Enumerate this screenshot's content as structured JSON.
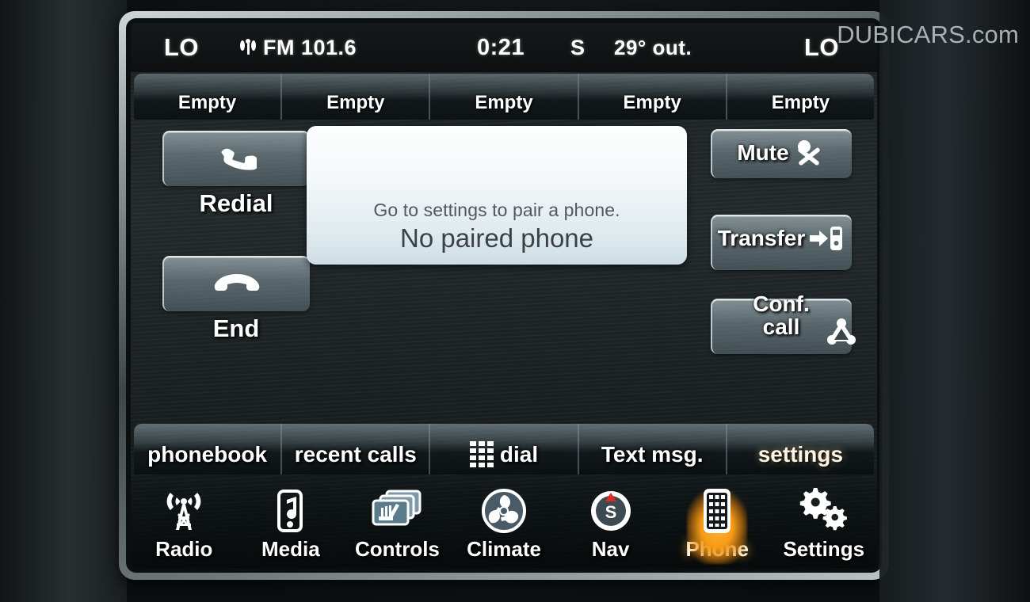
{
  "watermark": "DUBICARS.com",
  "status_bar": {
    "left_climate": "LO",
    "source_icon": "antenna-icon",
    "source": "FM 101.6",
    "time": "0:21",
    "gear": "S",
    "temperature": "29° out.",
    "right_climate": "LO"
  },
  "presets": [
    {
      "label": "Empty"
    },
    {
      "label": "Empty"
    },
    {
      "label": "Empty"
    },
    {
      "label": "Empty"
    },
    {
      "label": "Empty"
    }
  ],
  "left_buttons": [
    {
      "label": "Redial",
      "icon": "phone-handset-icon"
    },
    {
      "label": "End",
      "icon": "phone-hangup-icon"
    }
  ],
  "right_buttons": [
    {
      "label": "Mute",
      "icon": "microphone-muted-icon"
    },
    {
      "label": "Transfer",
      "icon": "transfer-to-phone-icon"
    },
    {
      "label": "Conf.",
      "label2": "call",
      "icon": "conference-call-icon"
    }
  ],
  "message": {
    "subtitle": "Go to settings to pair a phone.",
    "title": "No paired phone"
  },
  "tabs": [
    {
      "label": "phonebook",
      "icon": "",
      "selected": false
    },
    {
      "label": "recent calls",
      "icon": "",
      "selected": false
    },
    {
      "label": "dial",
      "icon": "keypad-icon",
      "selected": false
    },
    {
      "label": "Text msg.",
      "icon": "",
      "selected": false
    },
    {
      "label": "settings",
      "icon": "",
      "selected": true
    }
  ],
  "nav_items": [
    {
      "label": "Radio",
      "icon": "radio-tower-icon",
      "active": false
    },
    {
      "label": "Media",
      "icon": "media-player-icon",
      "active": false
    },
    {
      "label": "Controls",
      "icon": "seat-controls-icon",
      "active": false
    },
    {
      "label": "Climate",
      "icon": "climate-fan-icon",
      "active": false
    },
    {
      "label": "Nav",
      "icon": "compass-icon",
      "active": false
    },
    {
      "label": "Phone",
      "icon": "phone-keypad-icon",
      "active": true
    },
    {
      "label": "Settings",
      "icon": "gears-icon",
      "active": false
    }
  ],
  "colors": {
    "accent_highlight": "#ffb32e",
    "screen_text": "#ffffff",
    "message_text": "#3b4246",
    "status_bar_bg": "#0d1011"
  }
}
